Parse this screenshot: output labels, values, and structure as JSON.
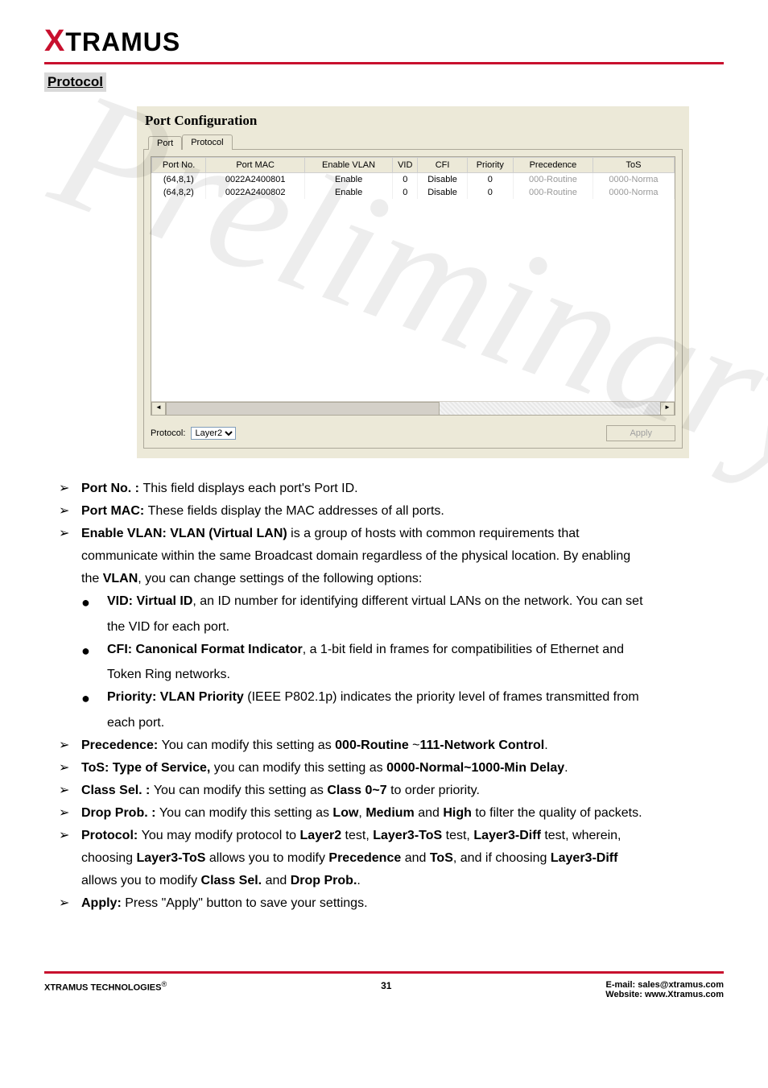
{
  "header": {
    "brand_x": "X",
    "brand_rest": "TRAMUS"
  },
  "section_title": "Protocol",
  "dialog": {
    "title": "Port Configuration",
    "tabs": {
      "port": "Port",
      "protocol": "Protocol"
    },
    "columns": [
      "Port No.",
      "Port MAC",
      "Enable VLAN",
      "VID",
      "CFI",
      "Priority",
      "Precedence",
      "ToS"
    ],
    "rows": [
      {
        "port_no": "(64,8,1)",
        "port_mac": "0022A2400801",
        "enable_vlan": "Enable",
        "vid": "0",
        "cfi": "Disable",
        "priority": "0",
        "precedence": "000-Routine",
        "tos": "0000-Norma"
      },
      {
        "port_no": "(64,8,2)",
        "port_mac": "0022A2400802",
        "enable_vlan": "Enable",
        "vid": "0",
        "cfi": "Disable",
        "priority": "0",
        "precedence": "000-Routine",
        "tos": "0000-Norma"
      }
    ],
    "protocol_label": "Protocol:",
    "protocol_value": "Layer2",
    "apply_label": "Apply"
  },
  "bullets": {
    "port_no": {
      "label": "Port No. : ",
      "text": "This field displays each port's Port ID."
    },
    "port_mac": {
      "label": "Port MAC: ",
      "text": "These fields display the MAC addresses of all ports."
    },
    "enable_vlan": {
      "label": "Enable VLAN: VLAN (Virtual LAN) ",
      "text1": "is a group of hosts with common requirements that",
      "text2": "communicate within the same Broadcast domain regardless of the physical location. By enabling",
      "text3_a": "the ",
      "text3_b": "VLAN",
      "text3_c": ", you can change settings of the following options:"
    },
    "vid": {
      "label": "VID: Virtual ID",
      "text1": ", an ID number for identifying different virtual LANs on the network. You can set",
      "text2": "the VID for each port."
    },
    "cfi": {
      "label": "CFI: Canonical Format Indicator",
      "text1": ", a 1-bit field in frames for compatibilities of Ethernet and",
      "text2": "Token Ring networks."
    },
    "priority": {
      "label": "Priority: VLAN Priority ",
      "text1": "(IEEE P802.1p) indicates the priority level of frames transmitted from",
      "text2": "each port."
    },
    "precedence": {
      "label": "Precedence: ",
      "text1": "You can modify this setting as ",
      "b1": "000-Routine ",
      "mid": "~",
      "b2": "111-Network Control",
      "end": "."
    },
    "tos": {
      "label": "ToS: Type of Service, ",
      "text1": "you can modify this setting as ",
      "b1": "0000-Normal~1000-Min Delay",
      "end": "."
    },
    "class_sel": {
      "label": "Class Sel. : ",
      "text1": "You can modify this setting as ",
      "b1": "Class 0~7",
      "end": " to order priority."
    },
    "drop_prob": {
      "label": "Drop Prob. : ",
      "text1": "You can modify this setting as ",
      "b1": "Low",
      "c1": ", ",
      "b2": "Medium",
      "c2": " and ",
      "b3": "High",
      "end": " to filter the quality of packets."
    },
    "protocol": {
      "label": "Protocol: ",
      "text1": "You may modify protocol to ",
      "b1": "Layer2",
      "t1": " test, ",
      "b2": "Layer3-ToS",
      "t2": " test, ",
      "b3": "Layer3-Diff",
      "t3": " test, wherein,",
      "line2a": "choosing ",
      "b4": "Layer3-ToS",
      "line2b": " allows you to modify ",
      "b5": "Precedence",
      "line2c": " and ",
      "b6": "ToS",
      "line2d": ", and if choosing ",
      "b7": "Layer3-Diff",
      "line3a": "allows you to modify ",
      "b8": "Class Sel.",
      "line3b": " and ",
      "b9": "Drop Prob.",
      "line3c": "."
    },
    "apply": {
      "label": "Apply: ",
      "text": "Press \"Apply\" button to save your settings."
    }
  },
  "footer": {
    "left_a": "XTRAMUS TECHNOLOGIES",
    "left_b": "®",
    "page_no": "31",
    "email_label": "E-mail: ",
    "email": "sales@xtramus.com",
    "website_label": "Website:  ",
    "website": "www.Xtramus.com"
  },
  "watermark": "Preliminary"
}
